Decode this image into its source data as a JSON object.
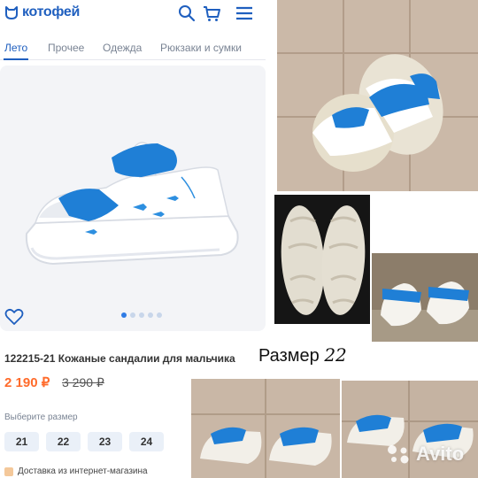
{
  "shop": {
    "logo_text": "котофей",
    "tabs": [
      {
        "label": "Лето",
        "active": true
      },
      {
        "label": "Прочее",
        "active": false
      },
      {
        "label": "Одежда",
        "active": false
      },
      {
        "label": "Рюкзаки и сумки",
        "active": false
      }
    ],
    "product": {
      "title": "122215-21 Кожаные сандалии для мальчика",
      "price": "2 190 ₽",
      "old_price": "3 290 ₽",
      "gallery_total": 5,
      "gallery_active": 1
    },
    "size_label": "Выберите размер",
    "sizes": [
      "21",
      "22",
      "23",
      "24"
    ],
    "delivery": "Доставка из интернет-магазина"
  },
  "caption": {
    "prefix": "Размер",
    "number": "22"
  },
  "watermark": "Avito",
  "colors": {
    "brand_blue": "#1f5fbf",
    "price_orange": "#ff6b2b",
    "sandal_blue": "#1f7fd6"
  },
  "icons": [
    "cat-logo-icon",
    "search-icon",
    "cart-icon",
    "menu-icon",
    "heart-icon",
    "avito-logo-icon"
  ]
}
